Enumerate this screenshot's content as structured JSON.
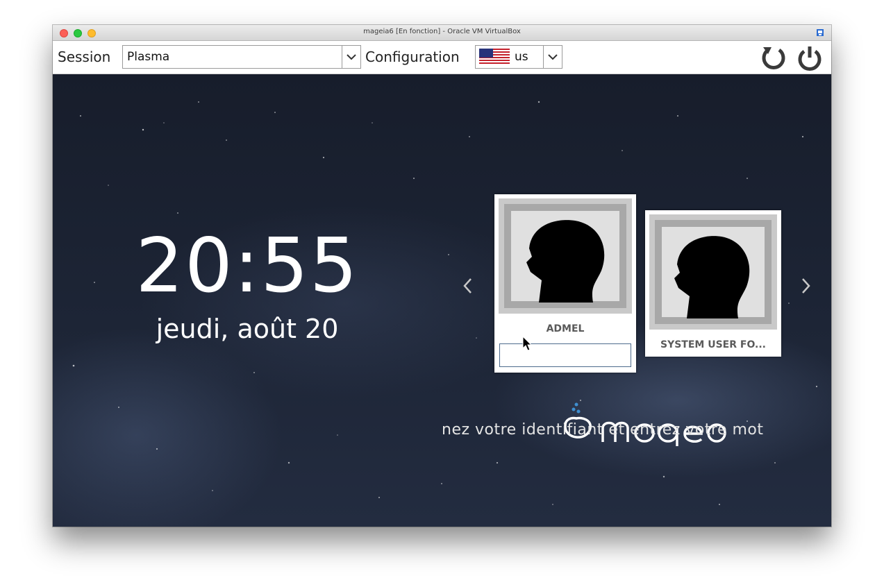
{
  "window": {
    "title": "mageia6 [En fonction] - Oracle VM VirtualBox"
  },
  "toolbar": {
    "session_label": "Session",
    "session_value": "Plasma",
    "config_label": "Configuration",
    "keyboard_layout": "us",
    "reboot_icon": "reboot-icon",
    "shutdown_icon": "power-icon"
  },
  "clock": {
    "time": "20:55",
    "date": "jeudi, août 20"
  },
  "users": [
    {
      "name": "ADMEL",
      "selected": true
    },
    {
      "name": "SYSTEM USER FO...",
      "selected": false
    }
  ],
  "password": {
    "value": ""
  },
  "hint": {
    "text": "nez votre identifiant et entrez votre mot"
  },
  "colors": {
    "background": "#1a2030",
    "accent": "#4c6a8c",
    "logo_blue": "#3f8fd0"
  }
}
